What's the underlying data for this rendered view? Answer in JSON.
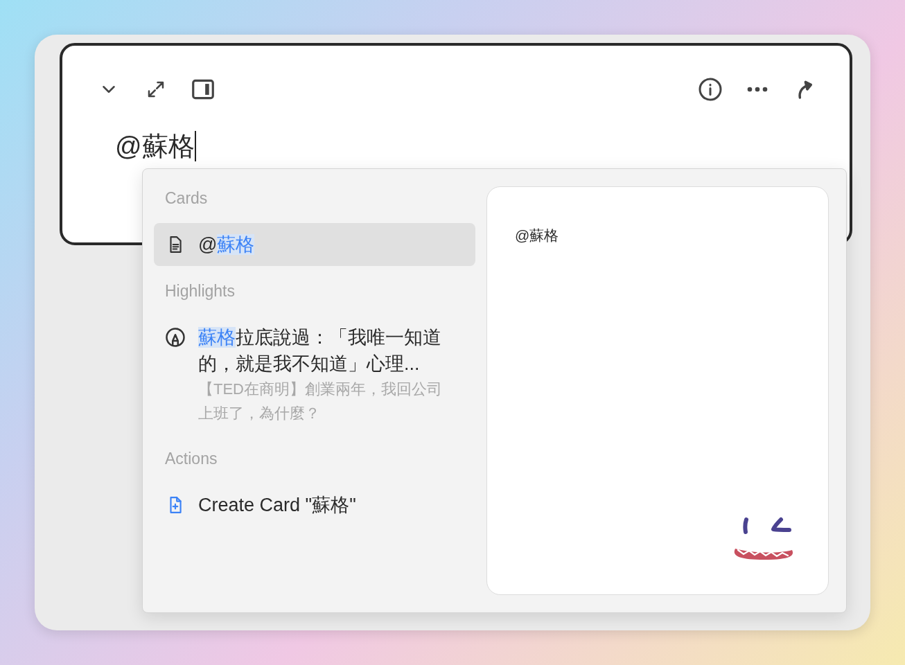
{
  "editor": {
    "title": "@蘇格"
  },
  "popup": {
    "sections": [
      {
        "heading": "Cards",
        "items": [
          {
            "kind": "card",
            "text": "@**蘇格**",
            "selected": true
          }
        ]
      },
      {
        "heading": "Highlights",
        "items": [
          {
            "kind": "highlight",
            "text": "**蘇格**拉底說過：「我唯一知道的，就是我不知道」心理...",
            "source": "【TED在商明】創業兩年，我回公司上班了，為什麼？",
            "selected": false
          }
        ]
      },
      {
        "heading": "Actions",
        "items": [
          {
            "kind": "action",
            "text": "Create Card \"蘇格\"",
            "selected": false
          }
        ]
      }
    ]
  },
  "preview": {
    "text": "@蘇格"
  }
}
